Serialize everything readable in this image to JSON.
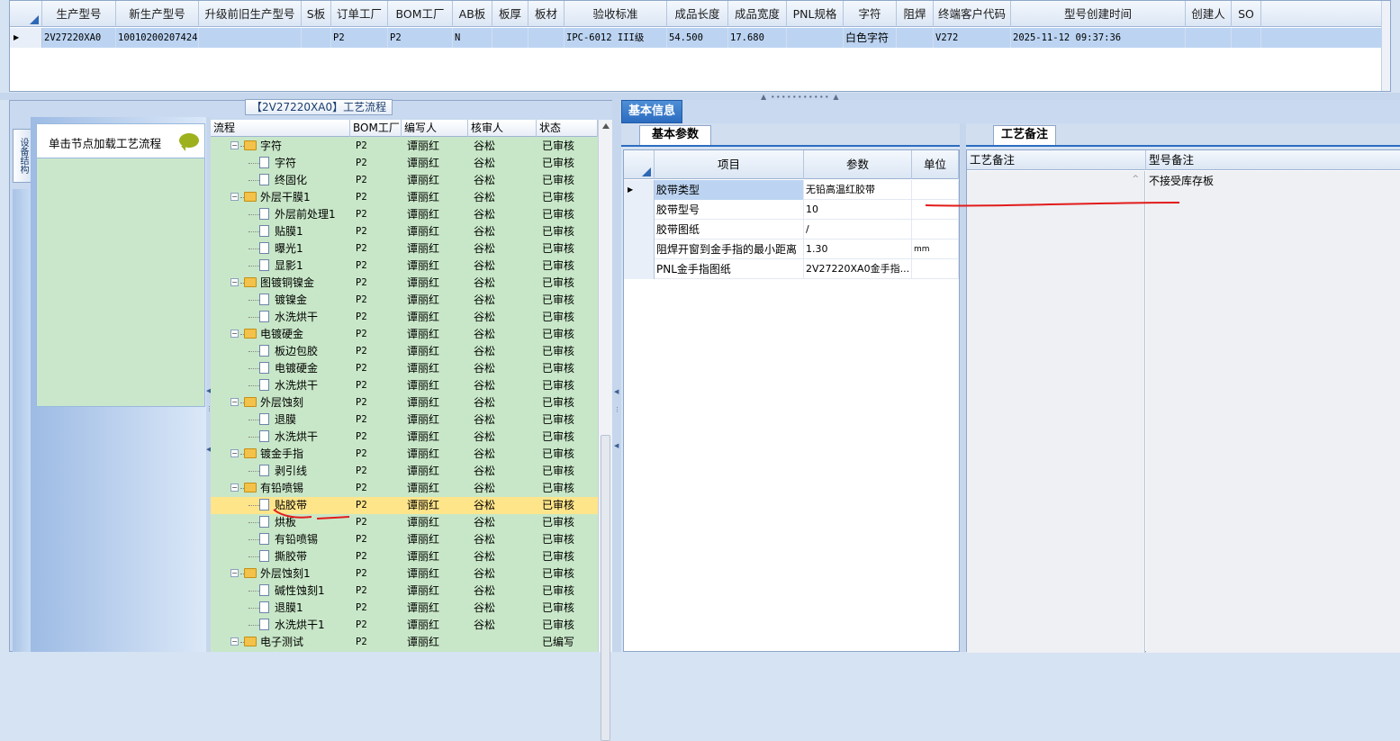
{
  "top_grid": {
    "columns": [
      "生产型号",
      "新生产型号",
      "升级前旧生产型号",
      "S板",
      "订单工厂",
      "BOM工厂",
      "AB板",
      "板厚",
      "板材",
      "验收标准",
      "成品长度",
      "成品宽度",
      "PNL规格",
      "字符",
      "阻焊",
      "终端客户代码",
      "型号创建时间",
      "创建人",
      "SO"
    ],
    "row": [
      "2V27220XA0",
      "10010200207424",
      "",
      "",
      "P2",
      "P2",
      "N",
      "",
      "",
      "IPC-6012 III级",
      "54.500",
      "17.680",
      "",
      "白色字符",
      "",
      "V272",
      "2025-11-12 09:37:36",
      "",
      ""
    ]
  },
  "flow_panel": {
    "title": "【2V27220XA0】工艺流程",
    "side_tab": "设备结构",
    "node_hint": "单击节点加载工艺流程",
    "columns": [
      "流程",
      "BOM工厂",
      "编写人",
      "核审人",
      "状态"
    ],
    "rows": [
      {
        "level": 0,
        "name": "字符",
        "bom": "P2",
        "writer": "谭丽红",
        "reviewer": "谷松",
        "status": "已审核"
      },
      {
        "level": 1,
        "name": "字符",
        "bom": "P2",
        "writer": "谭丽红",
        "reviewer": "谷松",
        "status": "已审核"
      },
      {
        "level": 1,
        "name": "终固化",
        "bom": "P2",
        "writer": "谭丽红",
        "reviewer": "谷松",
        "status": "已审核"
      },
      {
        "level": 0,
        "name": "外层干膜1",
        "bom": "P2",
        "writer": "谭丽红",
        "reviewer": "谷松",
        "status": "已审核"
      },
      {
        "level": 1,
        "name": "外层前处理1",
        "bom": "P2",
        "writer": "谭丽红",
        "reviewer": "谷松",
        "status": "已审核"
      },
      {
        "level": 1,
        "name": "贴膜1",
        "bom": "P2",
        "writer": "谭丽红",
        "reviewer": "谷松",
        "status": "已审核"
      },
      {
        "level": 1,
        "name": "曝光1",
        "bom": "P2",
        "writer": "谭丽红",
        "reviewer": "谷松",
        "status": "已审核"
      },
      {
        "level": 1,
        "name": "显影1",
        "bom": "P2",
        "writer": "谭丽红",
        "reviewer": "谷松",
        "status": "已审核"
      },
      {
        "level": 0,
        "name": "图镀铜镍金",
        "bom": "P2",
        "writer": "谭丽红",
        "reviewer": "谷松",
        "status": "已审核"
      },
      {
        "level": 1,
        "name": "镀镍金",
        "bom": "P2",
        "writer": "谭丽红",
        "reviewer": "谷松",
        "status": "已审核"
      },
      {
        "level": 1,
        "name": "水洗烘干",
        "bom": "P2",
        "writer": "谭丽红",
        "reviewer": "谷松",
        "status": "已审核"
      },
      {
        "level": 0,
        "name": "电镀硬金",
        "bom": "P2",
        "writer": "谭丽红",
        "reviewer": "谷松",
        "status": "已审核"
      },
      {
        "level": 1,
        "name": "板边包胶",
        "bom": "P2",
        "writer": "谭丽红",
        "reviewer": "谷松",
        "status": "已审核"
      },
      {
        "level": 1,
        "name": "电镀硬金",
        "bom": "P2",
        "writer": "谭丽红",
        "reviewer": "谷松",
        "status": "已审核"
      },
      {
        "level": 1,
        "name": "水洗烘干",
        "bom": "P2",
        "writer": "谭丽红",
        "reviewer": "谷松",
        "status": "已审核"
      },
      {
        "level": 0,
        "name": "外层蚀刻",
        "bom": "P2",
        "writer": "谭丽红",
        "reviewer": "谷松",
        "status": "已审核"
      },
      {
        "level": 1,
        "name": "退膜",
        "bom": "P2",
        "writer": "谭丽红",
        "reviewer": "谷松",
        "status": "已审核"
      },
      {
        "level": 1,
        "name": "水洗烘干",
        "bom": "P2",
        "writer": "谭丽红",
        "reviewer": "谷松",
        "status": "已审核"
      },
      {
        "level": 0,
        "name": "镀金手指",
        "bom": "P2",
        "writer": "谭丽红",
        "reviewer": "谷松",
        "status": "已审核"
      },
      {
        "level": 1,
        "name": "剥引线",
        "bom": "P2",
        "writer": "谭丽红",
        "reviewer": "谷松",
        "status": "已审核"
      },
      {
        "level": 0,
        "name": "有铅喷锡",
        "bom": "P2",
        "writer": "谭丽红",
        "reviewer": "谷松",
        "status": "已审核"
      },
      {
        "level": 1,
        "name": "贴胶带",
        "bom": "P2",
        "writer": "谭丽红",
        "reviewer": "谷松",
        "status": "已审核",
        "selected": true
      },
      {
        "level": 1,
        "name": "烘板",
        "bom": "P2",
        "writer": "谭丽红",
        "reviewer": "谷松",
        "status": "已审核"
      },
      {
        "level": 1,
        "name": "有铅喷锡",
        "bom": "P2",
        "writer": "谭丽红",
        "reviewer": "谷松",
        "status": "已审核"
      },
      {
        "level": 1,
        "name": "撕胶带",
        "bom": "P2",
        "writer": "谭丽红",
        "reviewer": "谷松",
        "status": "已审核"
      },
      {
        "level": 0,
        "name": "外层蚀刻1",
        "bom": "P2",
        "writer": "谭丽红",
        "reviewer": "谷松",
        "status": "已审核"
      },
      {
        "level": 1,
        "name": "碱性蚀刻1",
        "bom": "P2",
        "writer": "谭丽红",
        "reviewer": "谷松",
        "status": "已审核"
      },
      {
        "level": 1,
        "name": "退膜1",
        "bom": "P2",
        "writer": "谭丽红",
        "reviewer": "谷松",
        "status": "已审核"
      },
      {
        "level": 1,
        "name": "水洗烘干1",
        "bom": "P2",
        "writer": "谭丽红",
        "reviewer": "谷松",
        "status": "已审核"
      },
      {
        "level": 0,
        "name": "电子测试",
        "bom": "P2",
        "writer": "谭丽红",
        "reviewer": "",
        "status": "已编写"
      }
    ]
  },
  "basic_info": {
    "tab": "基本信息",
    "params_tab": "基本参数",
    "columns": [
      "项目",
      "参数",
      "单位"
    ],
    "rows": [
      {
        "item": "胶带类型",
        "value": "无铅高温红胶带",
        "unit": ""
      },
      {
        "item": "胶带型号",
        "value": "10",
        "unit": ""
      },
      {
        "item": "胶带图纸",
        "value": "/",
        "unit": ""
      },
      {
        "item": "阻焊开窗到金手指的最小距离",
        "value": "1.30",
        "unit": "mm"
      },
      {
        "item": "PNL金手指图纸",
        "value": "2V27220XA0金手指...",
        "unit": ""
      }
    ]
  },
  "process_notes": {
    "tab": "工艺备注",
    "columns": [
      "工艺备注",
      "型号备注"
    ],
    "model_note": "不接受库存板"
  },
  "colors": {
    "annotation_red": "#e21b1b",
    "selected_row": "#ffe58a",
    "tree_bg": "#c8e7c8",
    "tab_blue": "#2b6cc0"
  }
}
